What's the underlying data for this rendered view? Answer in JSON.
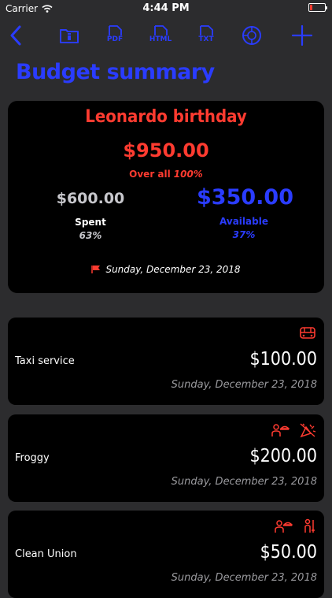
{
  "status_bar": {
    "carrier": "Carrier",
    "time": "4:44 PM"
  },
  "toolbar": {
    "accent_color": "#2a3cff",
    "pdf": "PDF",
    "html": "HTML",
    "txt": "TXT"
  },
  "page": {
    "title": "Budget summary"
  },
  "summary": {
    "event_name": "Leonardo birthday",
    "total": "$950.00",
    "overall_label": "Over all",
    "overall_pct": "100%",
    "spent_amount": "$600.00",
    "spent_label": "Spent",
    "spent_pct": "63%",
    "available_amount": "$350.00",
    "available_label": "Available",
    "available_pct": "37%",
    "date": "Sunday, December 23, 2018",
    "colors": {
      "total": "#ff3b30",
      "available": "#2a3cff",
      "spent": "#c7c7cc"
    }
  },
  "expenses": [
    {
      "name": "Taxi service",
      "amount": "$100.00",
      "date": "Sunday, December 23, 2018",
      "icons": [
        "bus-icon"
      ]
    },
    {
      "name": "Froggy",
      "amount": "$200.00",
      "date": "Sunday, December 23, 2018",
      "icons": [
        "waiter-icon",
        "party-icon"
      ]
    },
    {
      "name": "Clean Union",
      "amount": "$50.00",
      "date": "Sunday, December 23, 2018",
      "icons": [
        "waiter-icon",
        "cleaning-icon"
      ]
    }
  ]
}
